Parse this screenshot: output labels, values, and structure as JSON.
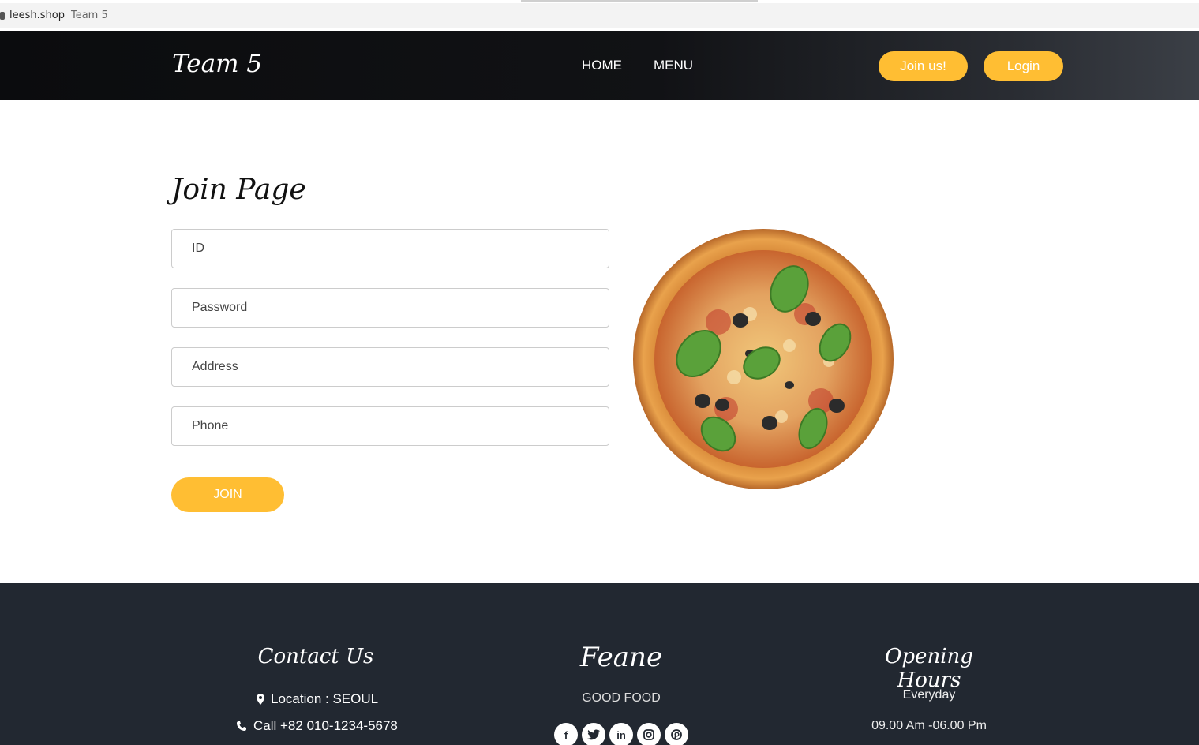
{
  "browser": {
    "domain": "leesh.shop",
    "page_title": "Team 5"
  },
  "header": {
    "brand": "Team 5",
    "nav": [
      "HOME",
      "MENU"
    ],
    "join_label": "Join us!",
    "login_label": "Login",
    "accent_color": "#ffbe33"
  },
  "form": {
    "title": "Join Page",
    "fields": [
      "ID",
      "Password",
      "Address",
      "Phone"
    ],
    "submit_label": "JOIN"
  },
  "footer": {
    "contact_title": "Contact Us",
    "location": "Location : SEOUL",
    "phone": "Call +82 010-1234-5678",
    "brand_title": "Feane",
    "brand_sub": "GOOD FOOD",
    "social": [
      "facebook-icon",
      "twitter-icon",
      "linkedin-icon",
      "instagram-icon",
      "pinterest-icon"
    ],
    "hours_title": "Opening Hours",
    "hours_days": "Everyday",
    "hours_time": "09.00 Am -06.00 Pm"
  }
}
